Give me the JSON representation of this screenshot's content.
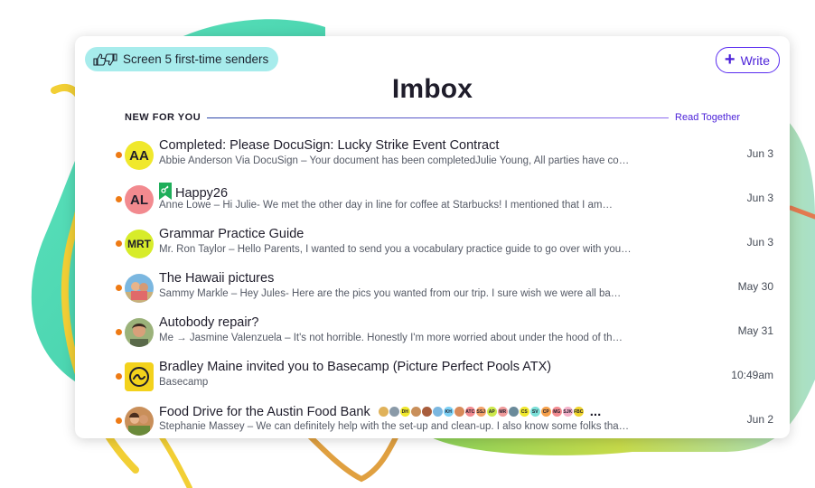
{
  "screen_pill": {
    "label": "Screen 5 first-time senders"
  },
  "write_button": {
    "label": "Write"
  },
  "title": "Imbox",
  "section": {
    "label": "NEW FOR YOU",
    "action": "Read Together"
  },
  "emails": [
    {
      "initials": "AA",
      "avatar_color": "#f0e82c",
      "subject": "Completed: Please DocuSign: Lucky Strike Event Contract",
      "preview": "Abbie Anderson Via DocuSign – Your document has been completedJulie Young, All parties have co…",
      "date": "Jun 3",
      "icon": "initials-avatar"
    },
    {
      "initials": "AL",
      "avatar_color": "#f28a8f",
      "subject": "Happy26",
      "preview": "Anne Lowe – Hi Julie- We met the other day in line for coffee at Starbucks! I mentioned that I am…",
      "date": "Jun 3",
      "icon": "initials-avatar",
      "tag": "bookmark-tag-icon"
    },
    {
      "initials": "MRT",
      "avatar_color": "#d7ec2a",
      "subject": "Grammar Practice Guide",
      "preview": "Mr. Ron Taylor – Hello Parents, I wanted to send you a vocabulary practice guide to go over with you…",
      "date": "Jun 3",
      "icon": "initials-avatar"
    },
    {
      "initials": "",
      "avatar_color": "#7bb7e0",
      "subject": "The Hawaii pictures",
      "preview": "Sammy Markle – Hey Jules- Here are the pics you wanted from our trip. I sure wish we were all ba…",
      "date": "May 30",
      "icon": "photo-avatar"
    },
    {
      "initials": "",
      "avatar_color": "#9bb27a",
      "subject": "Autobody repair?",
      "preview": "Me → Jasmine Valenzuela – It's not horrible. Honestly I'm more worried about under the hood of th…",
      "date": "May 31",
      "icon": "photo-avatar"
    },
    {
      "initials": "",
      "avatar_color": "#f3d21c",
      "subject": "Bradley Maine invited you to Basecamp (Picture Perfect Pools ATX)",
      "preview": "Basecamp",
      "date": "10:49am",
      "icon": "basecamp-logo-icon"
    },
    {
      "initials": "",
      "avatar_color": "#c98f5a",
      "subject": "Food Drive for the Austin Food Bank",
      "preview": "Stephanie Massey – We can definitely help with the set-up and clean-up. I also know some folks tha…",
      "date": "Jun 2",
      "icon": "photo-avatar",
      "more": "..."
    }
  ],
  "participants": [
    {
      "initials": "",
      "color": "#e0b25a"
    },
    {
      "initials": "",
      "color": "#8a9aa8"
    },
    {
      "initials": "DH",
      "color": "#f0e82c"
    },
    {
      "initials": "",
      "color": "#c98f5a"
    },
    {
      "initials": "",
      "color": "#a85d3c"
    },
    {
      "initials": "",
      "color": "#7bb7e0"
    },
    {
      "initials": "KH",
      "color": "#7bd0f5"
    },
    {
      "initials": "",
      "color": "#d88a5a"
    },
    {
      "initials": "ATC",
      "color": "#f28a8f"
    },
    {
      "initials": "SSJ",
      "color": "#f4a26a"
    },
    {
      "initials": "AP",
      "color": "#cce84a"
    },
    {
      "initials": "MR",
      "color": "#ef9a9a"
    },
    {
      "initials": "",
      "color": "#6a8a9a"
    },
    {
      "initials": "CS",
      "color": "#f0e82c"
    },
    {
      "initials": "SV",
      "color": "#7be0d8"
    },
    {
      "initials": "CP",
      "color": "#f6a04a"
    },
    {
      "initials": "MG",
      "color": "#f28a8f"
    },
    {
      "initials": "SJK",
      "color": "#f4b0c8"
    },
    {
      "initials": "FBC",
      "color": "#f0d42c"
    }
  ],
  "colors": {
    "accent": "#5a2cf0",
    "unread_dot": "#ee7a14",
    "pill_bg": "#a7ecec"
  }
}
